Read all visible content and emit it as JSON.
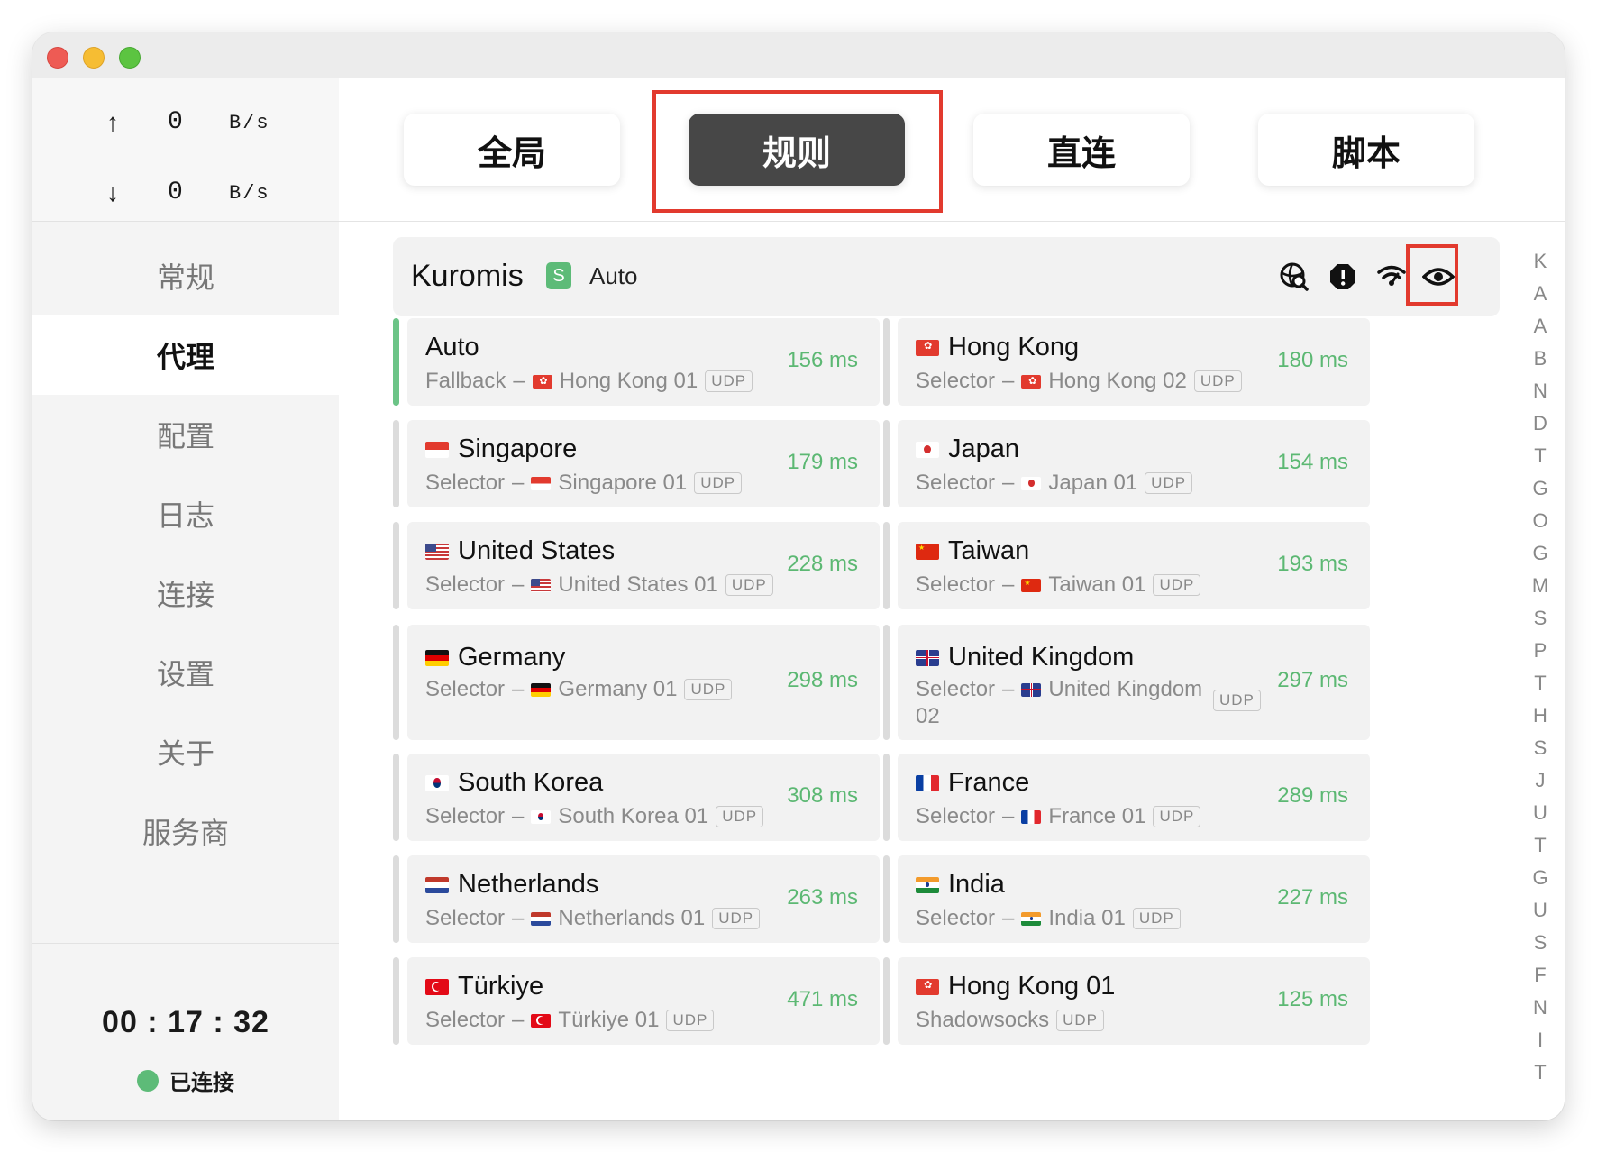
{
  "window": {
    "traffic_lights": [
      "close",
      "minimize",
      "zoom"
    ]
  },
  "sidebar": {
    "upload": {
      "arrow": "↑",
      "value": "0",
      "unit": "B/s"
    },
    "download": {
      "arrow": "↓",
      "value": "0",
      "unit": "B/s"
    },
    "nav": [
      {
        "label": "常规",
        "active": false
      },
      {
        "label": "代理",
        "active": true
      },
      {
        "label": "配置",
        "active": false
      },
      {
        "label": "日志",
        "active": false
      },
      {
        "label": "连接",
        "active": false
      },
      {
        "label": "设置",
        "active": false
      },
      {
        "label": "关于",
        "active": false
      },
      {
        "label": "服务商",
        "active": false
      }
    ],
    "timer": "00 : 17 : 32",
    "status": "已连接"
  },
  "modes": [
    {
      "label": "全局",
      "active": false
    },
    {
      "label": "规则",
      "active": true
    },
    {
      "label": "直连",
      "active": false
    },
    {
      "label": "脚本",
      "active": false
    }
  ],
  "group": {
    "name": "Kuromis",
    "badge": "S",
    "selected": "Auto",
    "icons": [
      "search-globe-icon",
      "alert-icon",
      "wifi-test-icon",
      "eye-icon"
    ]
  },
  "proxies": [
    {
      "name": "Auto",
      "flag": "",
      "type": "Fallback",
      "node_flag": "hk",
      "node": "Hong Kong 01",
      "udp": "UDP",
      "latency": "156 ms",
      "active": true
    },
    {
      "name": "Hong Kong",
      "flag": "hk",
      "type": "Selector",
      "node_flag": "hk",
      "node": "Hong Kong 02",
      "udp": "UDP",
      "latency": "180 ms",
      "active": false
    },
    {
      "name": "Singapore",
      "flag": "sg",
      "type": "Selector",
      "node_flag": "sg",
      "node": "Singapore 01",
      "udp": "UDP",
      "latency": "179 ms",
      "active": false
    },
    {
      "name": "Japan",
      "flag": "jp",
      "type": "Selector",
      "node_flag": "jp",
      "node": "Japan 01",
      "udp": "UDP",
      "latency": "154 ms",
      "active": false
    },
    {
      "name": "United States",
      "flag": "us",
      "type": "Selector",
      "node_flag": "us",
      "node": "United States 01",
      "udp": "UDP",
      "latency": "228 ms",
      "active": false
    },
    {
      "name": "Taiwan",
      "flag": "cn",
      "type": "Selector",
      "node_flag": "cn",
      "node": "Taiwan 01",
      "udp": "UDP",
      "latency": "193 ms",
      "active": false
    },
    {
      "name": "Germany",
      "flag": "de",
      "type": "Selector",
      "node_flag": "de",
      "node": "Germany 01",
      "udp": "UDP",
      "latency": "298 ms",
      "active": false
    },
    {
      "name": "United Kingdom",
      "flag": "gb",
      "type": "Selector",
      "node_flag": "gb",
      "node": "United Kingdom",
      "node_line2": "02",
      "udp": "UDP",
      "latency": "297 ms",
      "active": false
    },
    {
      "name": "South Korea",
      "flag": "kr",
      "type": "Selector",
      "node_flag": "kr",
      "node": "South Korea 01",
      "udp": "UDP",
      "latency": "308 ms",
      "active": false
    },
    {
      "name": "France",
      "flag": "fr",
      "type": "Selector",
      "node_flag": "fr",
      "node": "France 01",
      "udp": "UDP",
      "latency": "289 ms",
      "active": false
    },
    {
      "name": "Netherlands",
      "flag": "nl",
      "type": "Selector",
      "node_flag": "nl",
      "node": "Netherlands 01",
      "udp": "UDP",
      "latency": "263 ms",
      "active": false
    },
    {
      "name": "India",
      "flag": "in",
      "type": "Selector",
      "node_flag": "in",
      "node": "India 01",
      "udp": "UDP",
      "latency": "227 ms",
      "active": false
    },
    {
      "name": "Türkiye",
      "flag": "tr",
      "type": "Selector",
      "node_flag": "tr",
      "node": "Türkiye 01",
      "udp": "UDP",
      "latency": "471 ms",
      "active": false
    },
    {
      "name": "Hong Kong 01",
      "flag": "hk",
      "type": "Shadowsocks",
      "node_flag": "",
      "node": "",
      "udp": "UDP",
      "latency": "125 ms",
      "active": false
    }
  ],
  "index_letters": [
    "K",
    "A",
    "A",
    "B",
    "N",
    "D",
    "T",
    "G",
    "O",
    "G",
    "M",
    "S",
    "P",
    "T",
    "H",
    "S",
    "J",
    "U",
    "T",
    "G",
    "U",
    "S",
    "F",
    "N",
    "I",
    "T"
  ],
  "colors": {
    "accent_green": "#5cb873",
    "highlight_red": "#e23a2e",
    "active_mode": "#474747"
  }
}
